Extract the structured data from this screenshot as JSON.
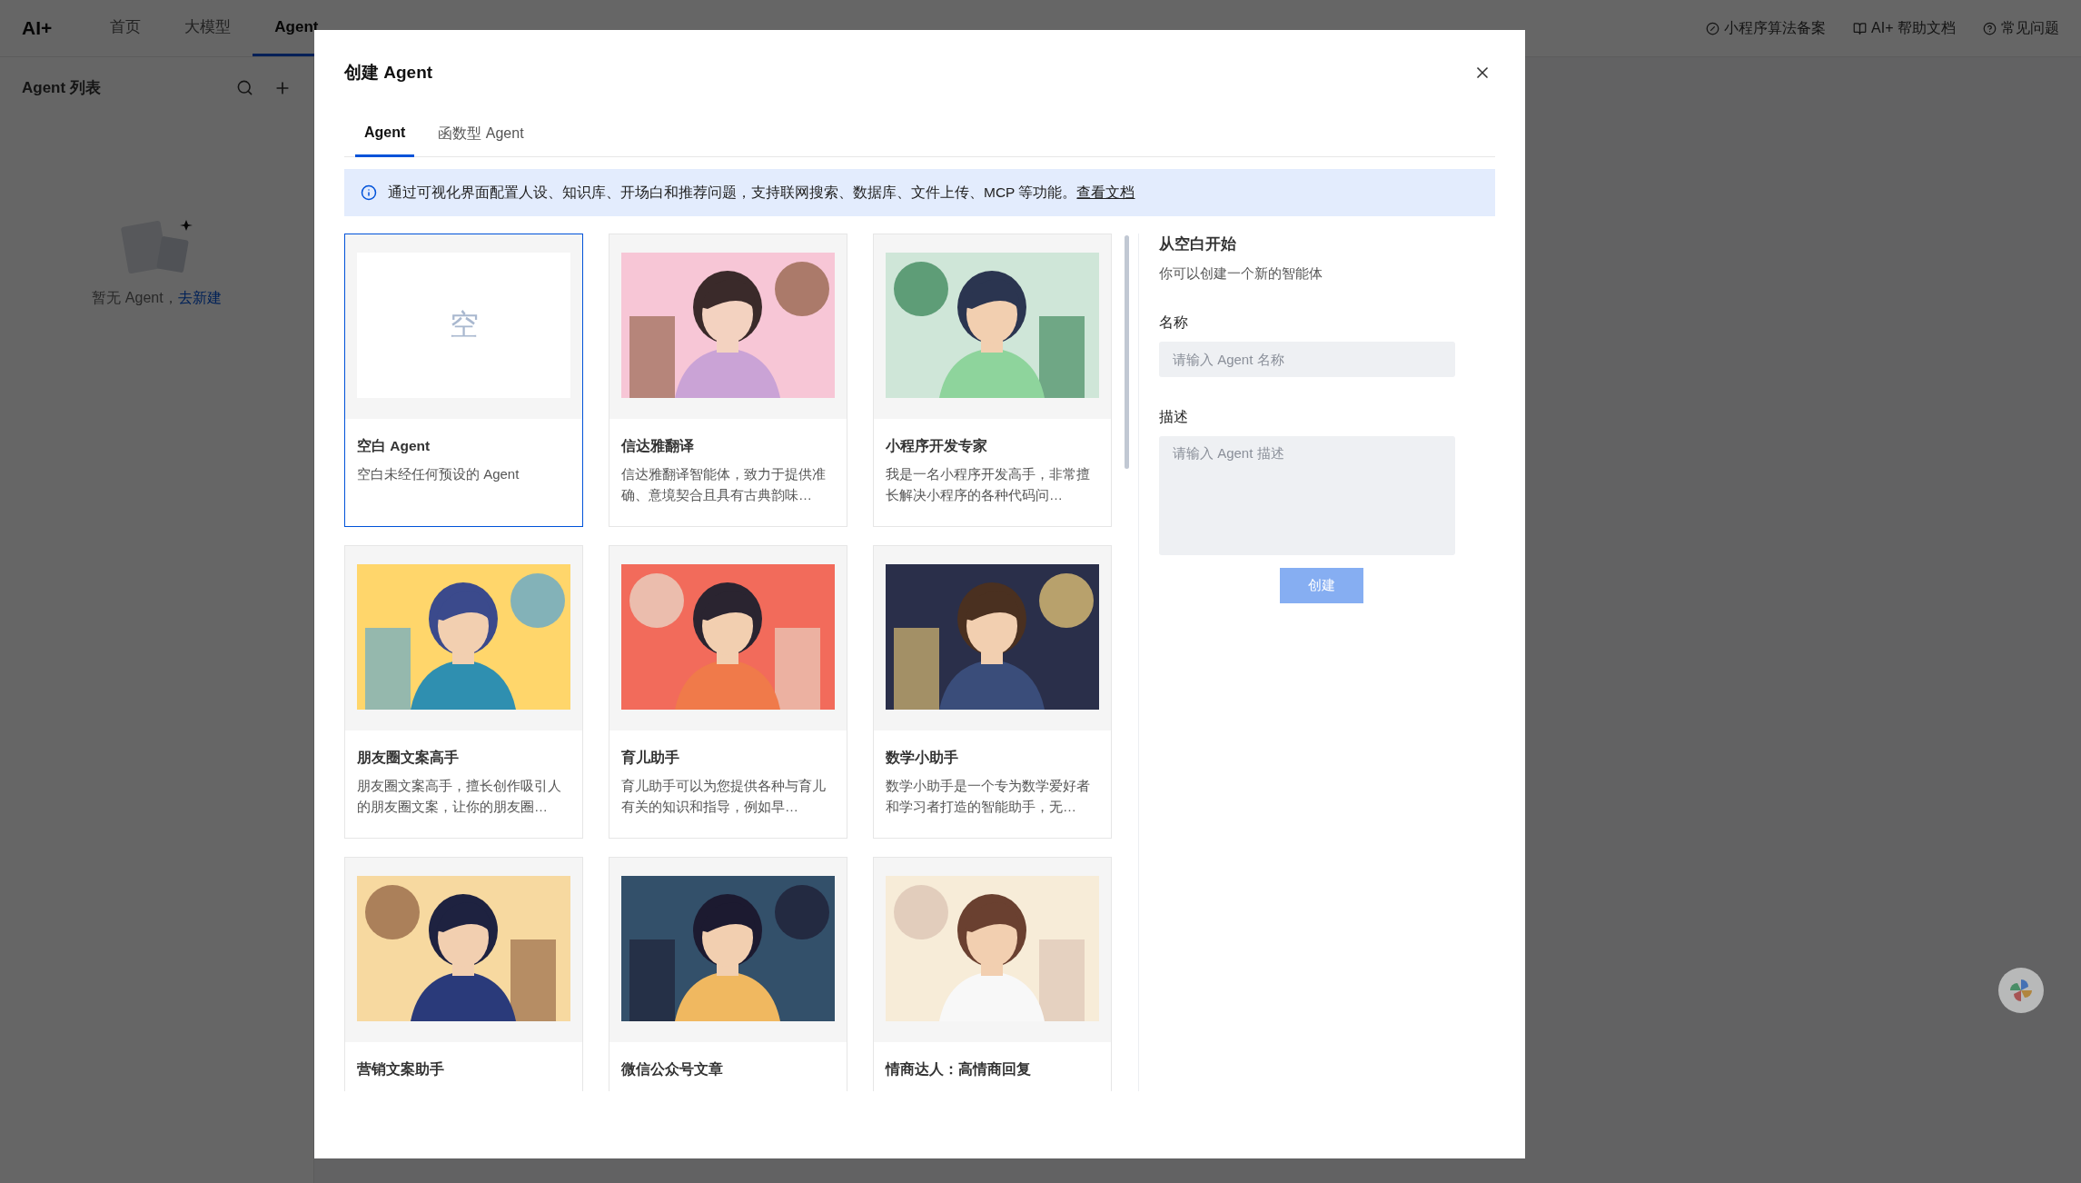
{
  "topbar": {
    "logo": "AI+",
    "nav": [
      {
        "label": "首页",
        "selected": false
      },
      {
        "label": "大模型",
        "selected": false
      },
      {
        "label": "Agent",
        "selected": true
      }
    ],
    "links": [
      {
        "label": "小程序算法备案"
      },
      {
        "label": "AI+ 帮助文档"
      },
      {
        "label": "常见问题"
      }
    ]
  },
  "sidebar": {
    "title": "Agent 列表",
    "empty_text": "暂无 Agent，",
    "empty_link": "去新建"
  },
  "modal": {
    "title": "创建 Agent",
    "tabs": [
      {
        "label": "Agent",
        "selected": true
      },
      {
        "label": "函数型 Agent",
        "selected": false
      }
    ],
    "notice": {
      "text": "通过可视化界面配置人设、知识库、开场白和推荐问题，支持联网搜索、数据库、文件上传、MCP 等功能。",
      "link": "查看文档"
    },
    "cards": [
      {
        "kind": "blank",
        "mark": "空",
        "title": "空白 Agent",
        "description": "空白未经任何预设的 Agent",
        "selected": true
      },
      {
        "kind": "picture",
        "title": "信达雅翻译",
        "description": "信达雅翻译智能体，致力于提供准确、意境契合且具有古典韵味…",
        "selected": false
      },
      {
        "kind": "picture",
        "title": "小程序开发专家",
        "description": "我是一名小程序开发高手，非常擅长解决小程序的各种代码问…",
        "selected": false
      },
      {
        "kind": "picture",
        "title": "朋友圈文案高手",
        "description": "朋友圈文案高手，擅长创作吸引人的朋友圈文案，让你的朋友圈…",
        "selected": false
      },
      {
        "kind": "picture",
        "title": "育儿助手",
        "description": "育儿助手可以为您提供各种与育儿有关的知识和指导，例如早…",
        "selected": false
      },
      {
        "kind": "picture",
        "title": "数学小助手",
        "description": "数学小助手是一个专为数学爱好者和学习者打造的智能助手，无…",
        "selected": false
      },
      {
        "kind": "picture",
        "title": "营销文案助手",
        "selected": false
      },
      {
        "kind": "picture",
        "title": "微信公众号文章",
        "selected": false
      },
      {
        "kind": "picture",
        "title": "情商达人：高情商回复",
        "selected": false
      }
    ],
    "form": {
      "heading": "从空白开始",
      "subheading": "你可以创建一个新的智能体",
      "name_label": "名称",
      "name_placeholder": "请输入 Agent 名称",
      "desc_label": "描述",
      "desc_placeholder": "请输入 Agent 描述",
      "submit": "创建",
      "submit_disabled": true
    }
  }
}
